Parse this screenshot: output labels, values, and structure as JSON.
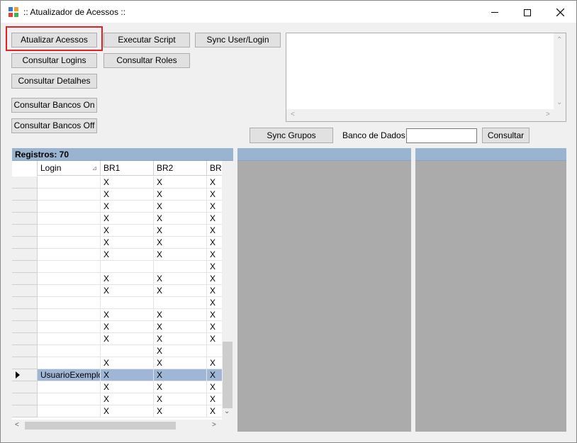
{
  "window": {
    "title": ":: Atualizador de Acessos ::"
  },
  "buttons": {
    "atualizar": "Atualizar Acessos",
    "executar": "Executar Script",
    "sync_user": "Sync User/Login",
    "consultar_logins": "Consultar Logins",
    "consultar_roles": "Consultar Roles",
    "consultar_detalhes": "Consultar Detalhes",
    "bancos_on": "Consultar Bancos On",
    "bancos_off": "Consultar Bancos Off",
    "sync_grupos": "Sync Grupos",
    "consultar": "Consultar"
  },
  "banco_label": "Banco de Dados",
  "banco_value": "",
  "log_text": "",
  "grid": {
    "registros": "Registros: 70",
    "columns": [
      "Login",
      "BR1",
      "BR2",
      "BR"
    ],
    "rows": [
      {
        "login": "",
        "br1": "X",
        "br2": "X",
        "br3": "X"
      },
      {
        "login": "",
        "br1": "X",
        "br2": "X",
        "br3": "X"
      },
      {
        "login": "",
        "br1": "X",
        "br2": "X",
        "br3": "X"
      },
      {
        "login": "",
        "br1": "X",
        "br2": "X",
        "br3": "X"
      },
      {
        "login": "",
        "br1": "X",
        "br2": "X",
        "br3": "X"
      },
      {
        "login": "",
        "br1": "X",
        "br2": "X",
        "br3": "X"
      },
      {
        "login": "",
        "br1": "X",
        "br2": "X",
        "br3": "X"
      },
      {
        "login": "",
        "br1": "",
        "br2": "",
        "br3": "X"
      },
      {
        "login": "",
        "br1": "X",
        "br2": "X",
        "br3": "X"
      },
      {
        "login": "",
        "br1": "X",
        "br2": "X",
        "br3": "X"
      },
      {
        "login": "",
        "br1": "",
        "br2": "",
        "br3": "X"
      },
      {
        "login": "",
        "br1": "X",
        "br2": "X",
        "br3": "X"
      },
      {
        "login": "",
        "br1": "X",
        "br2": "X",
        "br3": "X"
      },
      {
        "login": "",
        "br1": "X",
        "br2": "X",
        "br3": "X"
      },
      {
        "login": "",
        "br1": "",
        "br2": "X",
        "br3": ""
      },
      {
        "login": "",
        "br1": "X",
        "br2": "X",
        "br3": "X"
      },
      {
        "login": "UsuarioExemplo",
        "br1": "X",
        "br2": "X",
        "br3": "X"
      },
      {
        "login": "",
        "br1": "X",
        "br2": "X",
        "br3": "X"
      },
      {
        "login": "",
        "br1": "X",
        "br2": "X",
        "br3": "X"
      },
      {
        "login": "",
        "br1": "X",
        "br2": "X",
        "br3": "X"
      }
    ]
  }
}
